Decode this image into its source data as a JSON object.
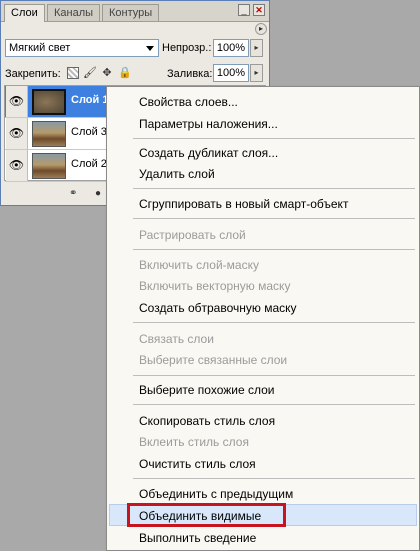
{
  "panel": {
    "tabs": [
      "Слои",
      "Каналы",
      "Контуры"
    ],
    "window_buttons": {
      "minimize": "_",
      "close": "✕"
    },
    "blend_mode": "Мягкий свет",
    "opacity_label": "Непрозр.:",
    "opacity_value": "100%",
    "lock_label": "Закрепить:",
    "fill_label": "Заливка:",
    "fill_value": "100%",
    "layers": [
      {
        "name": "Слой 1",
        "selected": true
      },
      {
        "name": "Слой 3",
        "selected": false
      },
      {
        "name": "Слой 2",
        "selected": false
      }
    ],
    "icons": {
      "eye": "eye-icon",
      "lock_pixels": "checkerboard-icon",
      "lock_brush": "brush-icon",
      "lock_move": "move-icon",
      "lock_all": "lock-icon",
      "link": "link-icon"
    }
  },
  "context_menu": {
    "items": [
      {
        "label": "Свойства слоев...",
        "enabled": true
      },
      {
        "label": "Параметры наложения...",
        "enabled": true
      },
      {
        "label": "Создать дубликат слоя...",
        "enabled": true
      },
      {
        "label": "Удалить слой",
        "enabled": true
      },
      {
        "label": "Сгруппировать в новый смарт-объект",
        "enabled": true
      },
      {
        "label": "Растрировать слой",
        "enabled": false
      },
      {
        "label": "Включить слой-маску",
        "enabled": false
      },
      {
        "label": "Включить векторную маску",
        "enabled": false
      },
      {
        "label": "Создать обтравочную маску",
        "enabled": true
      },
      {
        "label": "Связать слои",
        "enabled": false
      },
      {
        "label": "Выберите связанные слои",
        "enabled": false
      },
      {
        "label": "Выберите похожие слои",
        "enabled": true
      },
      {
        "label": "Скопировать стиль слоя",
        "enabled": true
      },
      {
        "label": "Вклеить стиль слоя",
        "enabled": false
      },
      {
        "label": "Очистить стиль слоя",
        "enabled": true
      },
      {
        "label": "Объединить с предыдущим",
        "enabled": true
      },
      {
        "label": "Объединить видимые",
        "enabled": true,
        "hovered": true,
        "highlighted": true
      },
      {
        "label": "Выполнить сведение",
        "enabled": true
      }
    ]
  },
  "colors": {
    "selection": "#3d80df",
    "highlight_box": "#c8151d",
    "menu_bg": "#f9f8f3"
  }
}
